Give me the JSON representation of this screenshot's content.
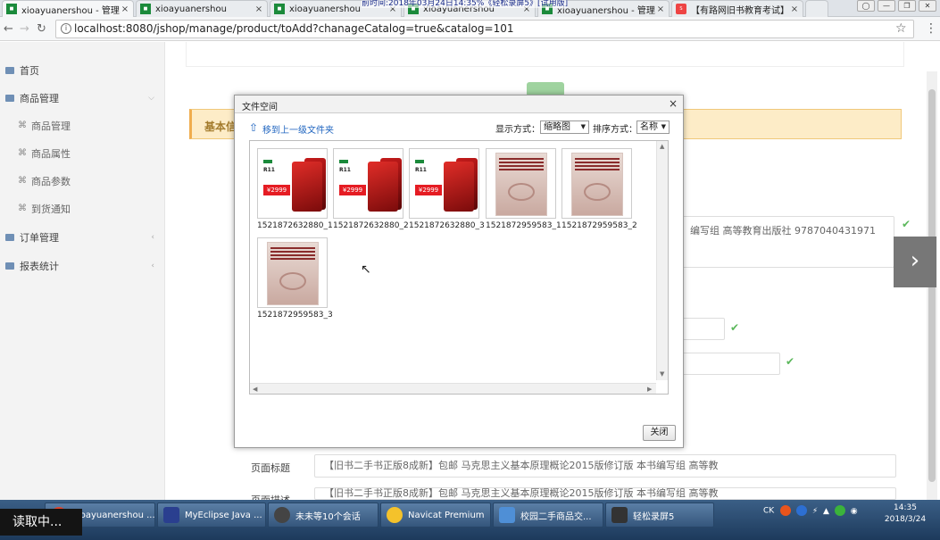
{
  "browser": {
    "tabs": [
      {
        "title": "xioayuanershou - 管理...",
        "icon": "green-logo",
        "active": true
      },
      {
        "title": "xioayuanershou",
        "icon": "green-logo"
      },
      {
        "title": "xioayuanershou",
        "icon": "green-logo"
      },
      {
        "title": "xioayuanershou",
        "icon": "green-logo"
      },
      {
        "title": "xioayuanershou - 管理...",
        "icon": "green-logo"
      },
      {
        "title": "【有路网旧书教育考试】",
        "icon": "red-logo"
      }
    ],
    "recording_overlay": "前时间:2018年03月24日14:35%《轻松录屏5》[试用版]",
    "url": "localhost:8080/jshop/manage/product/toAdd?chanageCatalog=true&catalog=101"
  },
  "sidebar": {
    "items": [
      {
        "label": "首页"
      },
      {
        "label": "商品管理"
      },
      {
        "label": "商品管理"
      },
      {
        "label": "商品属性"
      },
      {
        "label": "商品参数"
      },
      {
        "label": "到货通知"
      },
      {
        "label": "订单管理"
      },
      {
        "label": "报表统计"
      }
    ]
  },
  "form": {
    "section_title": "基本信",
    "field_partial_text": "编写组 高等教育出版社 9787040431971",
    "page_title_label": "页面标题",
    "page_title_value": "【旧书二手书正版8成新】包邮 马克思主义基本原理概论2015版修订版 本书编写组 高等教",
    "page_desc_label": "页面描述",
    "page_desc_value": "【旧书二手书正版8成新】包邮 马克思主义基本原理概论2015版修订版 本书编写组 高等教"
  },
  "dialog": {
    "title": "文件空间",
    "up_link": "移到上一级文件夹",
    "display_label": "显示方式：",
    "display_value": "缩略图",
    "sort_label": "排序方式：",
    "sort_value": "名称",
    "files": [
      {
        "name": "1521872632880_1",
        "kind": "phone"
      },
      {
        "name": "1521872632880_2",
        "kind": "phone"
      },
      {
        "name": "1521872632880_3",
        "kind": "phone"
      },
      {
        "name": "1521872959583_1",
        "kind": "book"
      },
      {
        "name": "1521872959583_2",
        "kind": "book"
      },
      {
        "name": "1521872959583_3",
        "kind": "book"
      }
    ],
    "phone_model": "R11",
    "phone_price": "¥2999",
    "close_button": "关闭"
  },
  "taskbar": {
    "reading_status": "读取中...",
    "buttons": [
      {
        "label": "xioayuanershou ..."
      },
      {
        "label": "MyEclipse Java ..."
      },
      {
        "label": "未未等10个会话"
      },
      {
        "label": "Navicat Premium"
      },
      {
        "label": "校园二手商品交..."
      },
      {
        "label": "轻松录屏5"
      }
    ],
    "tray_text": "CK",
    "time": "14:35",
    "date": "2018/3/24"
  },
  "colors": {
    "accent_blue": "#2166c0",
    "warning_bg": "#fdecc7",
    "ok_green": "#5cb85c",
    "price_red": "#e51c23"
  }
}
